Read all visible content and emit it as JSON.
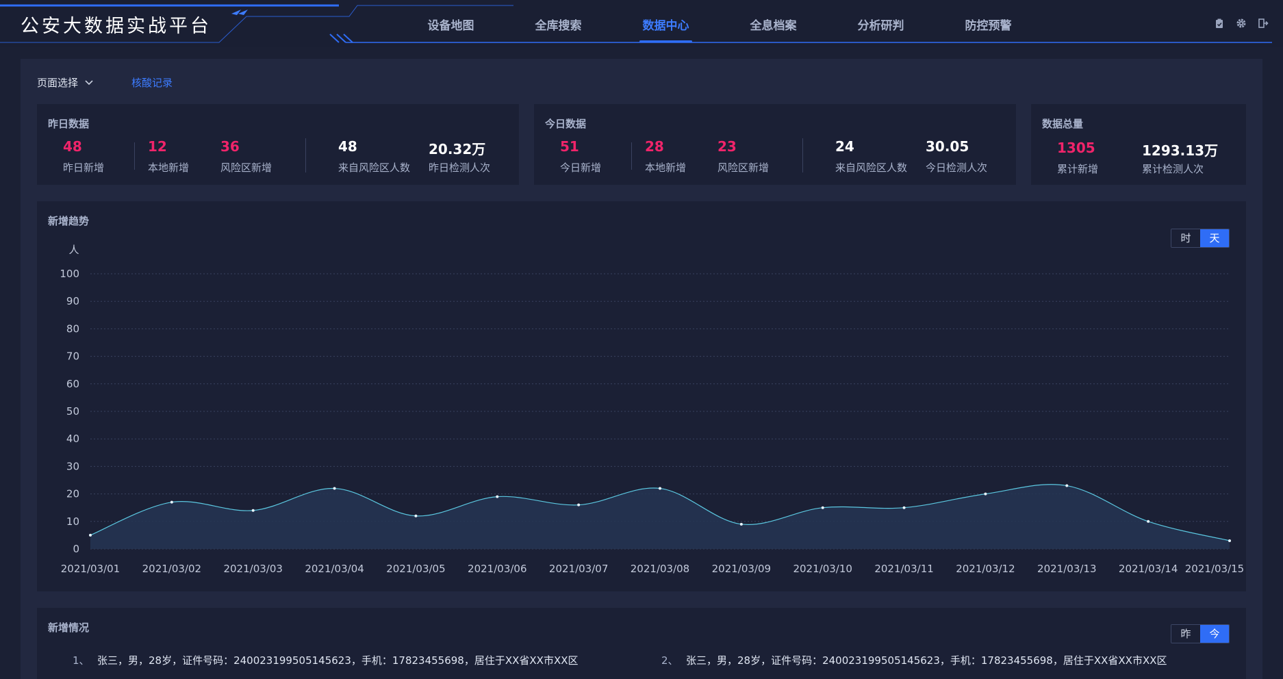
{
  "header": {
    "title": "公安大数据实战平台",
    "nav": [
      {
        "label": "设备地图"
      },
      {
        "label": "全库搜索"
      },
      {
        "label": "数据中心",
        "active": true
      },
      {
        "label": "全息档案"
      },
      {
        "label": "分析研判"
      },
      {
        "label": "防控预警"
      }
    ],
    "icons": [
      "clipboard-icon",
      "gear-icon",
      "logout-icon"
    ]
  },
  "toolbar": {
    "page_select": "页面选择",
    "link": "核酸记录"
  },
  "yesterday": {
    "title": "昨日数据",
    "stats": [
      {
        "value": "48",
        "label": "昨日新增",
        "highlight": true
      },
      {
        "value": "12",
        "label": "本地新增",
        "highlight": true
      },
      {
        "value": "36",
        "label": "风险区新增",
        "highlight": true
      },
      {
        "value": "48",
        "label": "来自风险区人数",
        "highlight": false
      },
      {
        "value": "20.32万",
        "label": "昨日检测人次",
        "highlight": false
      }
    ]
  },
  "today": {
    "title": "今日数据",
    "stats": [
      {
        "value": "51",
        "label": "今日新增",
        "highlight": true
      },
      {
        "value": "28",
        "label": "本地新增",
        "highlight": true
      },
      {
        "value": "23",
        "label": "风险区新增",
        "highlight": true
      },
      {
        "value": "24",
        "label": "来自风险区人数",
        "highlight": false
      },
      {
        "value": "30.05",
        "label": "今日检测人次",
        "highlight": false
      }
    ]
  },
  "total": {
    "title": "数据总量",
    "stats": [
      {
        "value": "1305",
        "label": "累计新增",
        "highlight": true
      },
      {
        "value": "1293.13万",
        "label": "累计检测人次",
        "highlight": false
      }
    ]
  },
  "trend": {
    "title": "新增趋势",
    "toggle": [
      {
        "label": "时",
        "active": false
      },
      {
        "label": "天",
        "active": true
      }
    ]
  },
  "chart_data": {
    "type": "area",
    "ylabel": "人",
    "ylim": [
      0,
      100
    ],
    "yticks": [
      0,
      10,
      20,
      30,
      40,
      50,
      60,
      70,
      80,
      90,
      100
    ],
    "grid": true,
    "categories": [
      "2021/03/01",
      "2021/03/02",
      "2021/03/03",
      "2021/03/04",
      "2021/03/05",
      "2021/03/06",
      "2021/03/07",
      "2021/03/08",
      "2021/03/09",
      "2021/03/10",
      "2021/03/11",
      "2021/03/12",
      "2021/03/13",
      "2021/03/14",
      "2021/03/15"
    ],
    "values": [
      5,
      17,
      14,
      22,
      12,
      19,
      16,
      22,
      9,
      15,
      15,
      20,
      23,
      10,
      3
    ],
    "colors": {
      "line": "#5bc7e0",
      "area": "#243552",
      "grid": "#3a4260",
      "axis_text": "#c3cadb"
    }
  },
  "new_cases": {
    "title": "新增情况",
    "toggle": [
      {
        "label": "昨",
        "active": false
      },
      {
        "label": "今",
        "active": true
      }
    ],
    "items": [
      {
        "num": "1、",
        "text": "张三，男，28岁，证件号码：240023199505145623，手机：17823455698，居住于XX省XX市XX区"
      },
      {
        "num": "2、",
        "text": "张三，男，28岁，证件号码：240023199505145623，手机：17823455698，居住于XX省XX市XX区"
      }
    ]
  }
}
